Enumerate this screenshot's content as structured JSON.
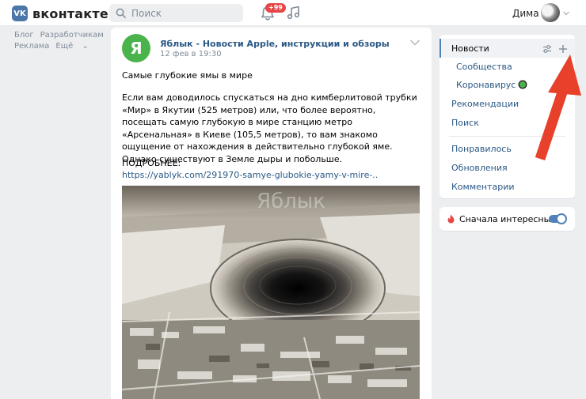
{
  "header": {
    "logo_mark": "VK",
    "logo_text": "вконтакте",
    "search_placeholder": "Поиск",
    "notifications_badge": "+99",
    "user_name": "Дима"
  },
  "left_links": {
    "row1": [
      "Блог",
      "Разработчикам"
    ],
    "row2": [
      "Реклама",
      "Ещё"
    ]
  },
  "post": {
    "avatar_letter": "Я",
    "author": "Яблык - Новости Apple, инструкции и обзоры",
    "date": "12 фев в 19:30",
    "title": "Самые глубокие ямы в мире",
    "body": "Если вам доводилось спускаться на дно кимберлитовой трубки «Мир» в Якутии (525 метров) или, что более вероятно, посещать самую глубокую в мире станцию метро «Арсенальная» в Киеве (105,5 метров), то вам знакомо ощущение от нахождения в действительно глубокой яме. Однако существуют в Земле дыры и побольше.",
    "more_label": "ПОДРОБНЕЕ:",
    "link": "https://yablyk.com/291970-samye-glubokie-yamy-v-mire-..",
    "photo_watermark": "Яблык"
  },
  "right_menu": {
    "items": [
      {
        "label": "Новости"
      },
      {
        "label": "Сообщества"
      },
      {
        "label": "Коронавирус"
      },
      {
        "label": "Рекомендации"
      },
      {
        "label": "Поиск"
      },
      {
        "label": "Понравилось"
      },
      {
        "label": "Обновления"
      },
      {
        "label": "Комментарии"
      }
    ]
  },
  "toggle": {
    "label": "Сначала интересные",
    "enabled": true
  },
  "colors": {
    "accent": "#5181b8",
    "link": "#2a5885",
    "badge": "#e64646",
    "annotation_arrow": "#e8412b"
  }
}
